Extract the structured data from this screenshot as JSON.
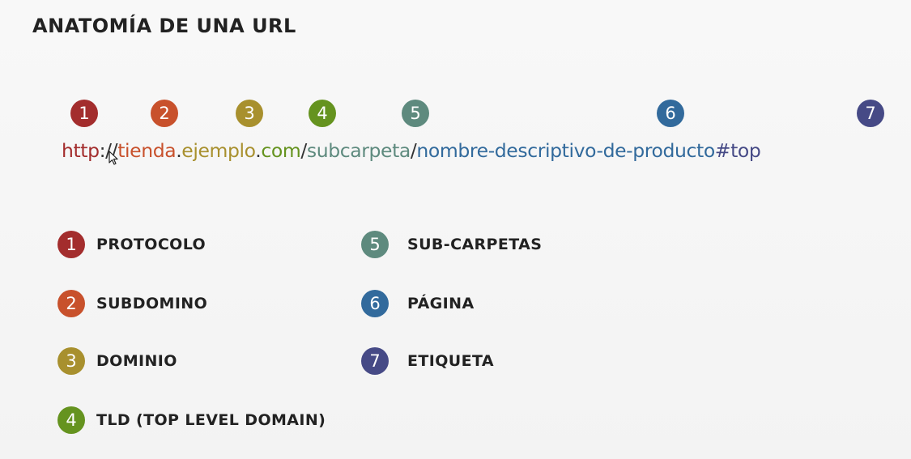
{
  "title": "ANATOMÍA DE UNA URL",
  "colors": {
    "protocol": "#a32d2d",
    "subdomain": "#c8512c",
    "domain": "#a8902e",
    "tld": "#65931f",
    "subfolder": "#5e8a7e",
    "page": "#326a9c",
    "tag": "#464a86",
    "separator": "#333333"
  },
  "badges": [
    "1",
    "2",
    "3",
    "4",
    "5",
    "6",
    "7"
  ],
  "url": {
    "protocol": "http",
    "protocol_sep": "://",
    "subdomain": "tienda",
    "dot1": ".",
    "domain": "ejemplo",
    "dot2": ".",
    "tld": "com",
    "slash1": "/",
    "subfolder": "subcarpeta",
    "slash2": "/",
    "page": "nombre-descriptivo-de-producto",
    "tag": "#top"
  },
  "legend": [
    {
      "number": "1",
      "label": "PROTOCOLO"
    },
    {
      "number": "2",
      "label": "SUBDOMINO"
    },
    {
      "number": "3",
      "label": "DOMINIO"
    },
    {
      "number": "4",
      "label": "TLD (TOP LEVEL DOMAIN)"
    },
    {
      "number": "5",
      "label": "SUB-CARPETAS"
    },
    {
      "number": "6",
      "label": "PÁGINA"
    },
    {
      "number": "7",
      "label": "ETIQUETA"
    }
  ]
}
